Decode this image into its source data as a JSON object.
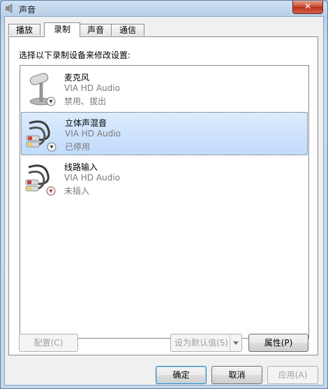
{
  "window": {
    "title": "声音",
    "close_symbol": "✕"
  },
  "tabs": [
    {
      "label": "播放",
      "active": false
    },
    {
      "label": "录制",
      "active": true
    },
    {
      "label": "声音",
      "active": false
    },
    {
      "label": "通信",
      "active": false
    }
  ],
  "panel": {
    "instruction": "选择以下录制设备来修改设置:"
  },
  "devices": [
    {
      "name": "麦克风",
      "driver": "VIA HD Audio",
      "status": "禁用、拔出",
      "icon": "microphone-icon",
      "badge": "down-arrow-gray",
      "selected": false
    },
    {
      "name": "立体声混音",
      "driver": "VIA HD Audio",
      "status": "已停用",
      "icon": "rca-cable-icon",
      "badge": "down-arrow-gray",
      "selected": true
    },
    {
      "name": "线路输入",
      "driver": "VIA HD Audio",
      "status": "未插入",
      "icon": "rca-cable-icon",
      "badge": "down-arrow-red",
      "selected": false
    }
  ],
  "buttons": {
    "configure": "配置(C)",
    "set_default": "设为默认值(S)",
    "properties": "属性(P)",
    "ok": "确定",
    "cancel": "取消",
    "apply": "应用(A)"
  },
  "colors": {
    "selection": "#c1dbfc",
    "title_bar": "#b9cfe8",
    "close_red": "#c6452c"
  }
}
